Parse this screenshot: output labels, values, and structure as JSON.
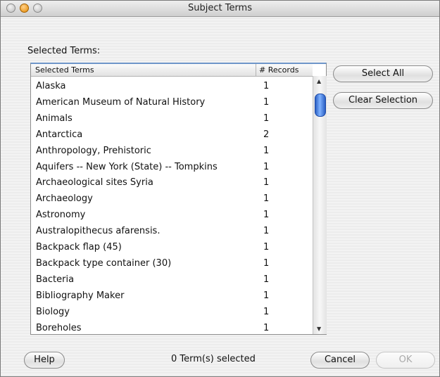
{
  "window": {
    "title": "Subject Terms"
  },
  "section_label": "Selected Terms:",
  "table": {
    "columns": [
      "Selected Terms",
      "# Records"
    ],
    "rows": [
      {
        "term": "Alaska",
        "count": "1"
      },
      {
        "term": "American Museum of Natural History",
        "count": "1"
      },
      {
        "term": "Animals",
        "count": "1"
      },
      {
        "term": "Antarctica",
        "count": "2"
      },
      {
        "term": "Anthropology, Prehistoric",
        "count": "1"
      },
      {
        "term": "Aquifers -- New York (State) -- Tompkins",
        "count": "1"
      },
      {
        "term": "Archaeological sites Syria",
        "count": "1"
      },
      {
        "term": "Archaeology",
        "count": "1"
      },
      {
        "term": "Astronomy",
        "count": "1"
      },
      {
        "term": "Australopithecus afarensis.",
        "count": "1"
      },
      {
        "term": "Backpack flap (45)",
        "count": "1"
      },
      {
        "term": "Backpack type container (30)",
        "count": "1"
      },
      {
        "term": "Bacteria",
        "count": "1"
      },
      {
        "term": "Bibliography Maker",
        "count": "1"
      },
      {
        "term": "Biology",
        "count": "1"
      },
      {
        "term": "Boreholes",
        "count": "1"
      }
    ]
  },
  "buttons": {
    "select_all": "Select All",
    "clear_selection": "Clear Selection",
    "help": "Help",
    "cancel": "Cancel",
    "ok": "OK"
  },
  "status": "0  Term(s) selected",
  "colors": {
    "accent": "#6e96c9",
    "scroll_thumb": "#2a5fc4",
    "minimize": "#e58a00"
  }
}
